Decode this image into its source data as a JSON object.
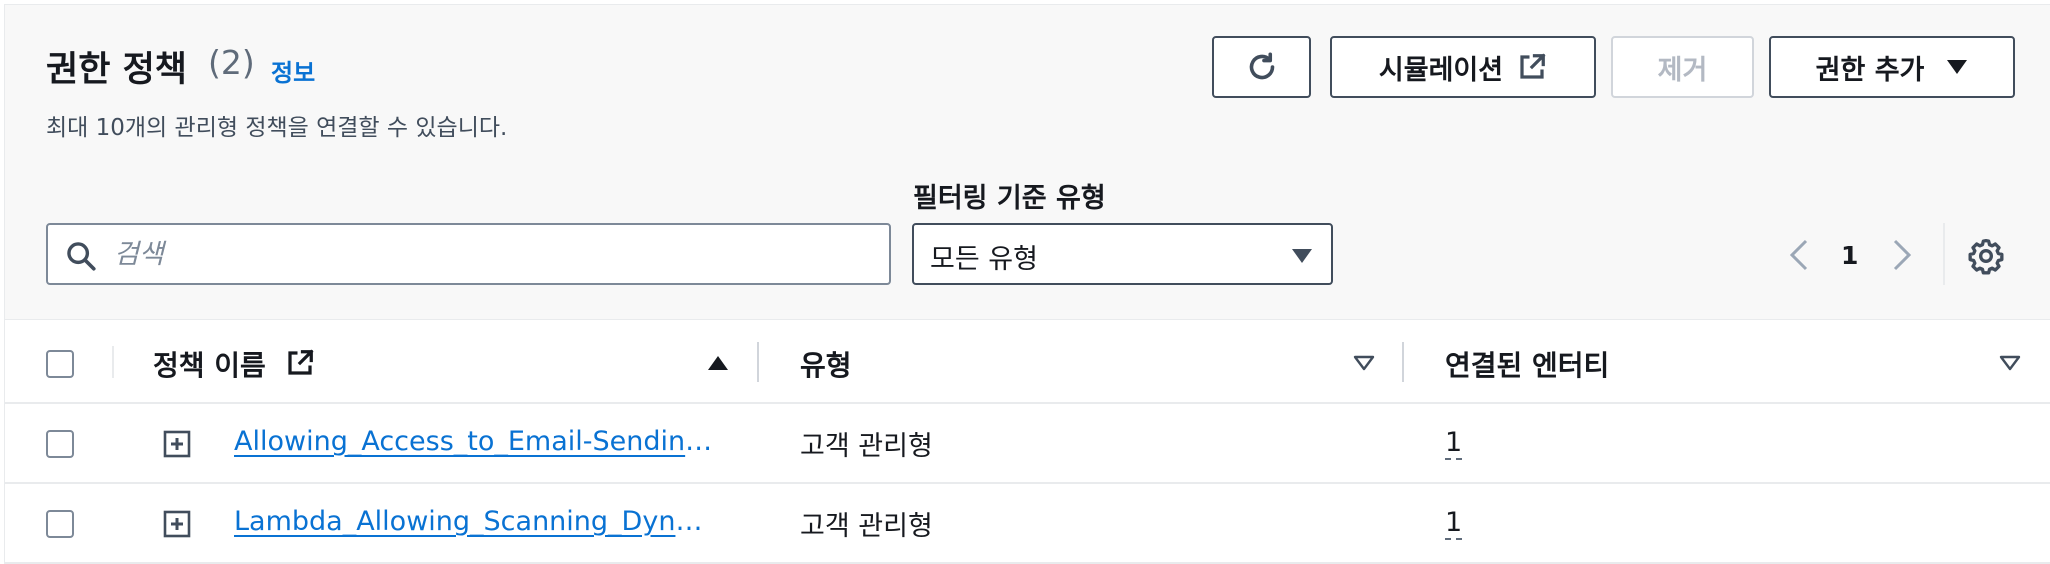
{
  "header": {
    "title": "권한 정책",
    "count": "(2)",
    "info": "정보",
    "description": "최대 10개의 관리형 정책을 연결할 수 있습니다."
  },
  "actions": {
    "refresh_icon": "refresh-icon",
    "simulation_label": "시뮬레이션",
    "remove_label": "제거",
    "add_permission_label": "권한 추가"
  },
  "filter": {
    "label": "필터링 기준 유형",
    "search_placeholder": "검색",
    "type_selected": "모든 유형"
  },
  "pagination": {
    "current_page": "1"
  },
  "table": {
    "columns": [
      {
        "label": "정책 이름",
        "sort": "ascending"
      },
      {
        "label": "유형",
        "sort": "none"
      },
      {
        "label": "연결된 엔터티",
        "sort": "none"
      }
    ],
    "rows": [
      {
        "name": "Allowing_Access_to_Email-Sending…",
        "type": "고객 관리형",
        "entities": "1"
      },
      {
        "name": "Lambda_Allowing_Scanning_Dyna…",
        "type": "고객 관리형",
        "entities": "1"
      }
    ]
  },
  "colors": {
    "link": "#0972d3",
    "text": "#16191f",
    "muted": "#5f6b7a",
    "disabled": "#b3b9c3",
    "panel_bg": "#f8f8f8"
  }
}
